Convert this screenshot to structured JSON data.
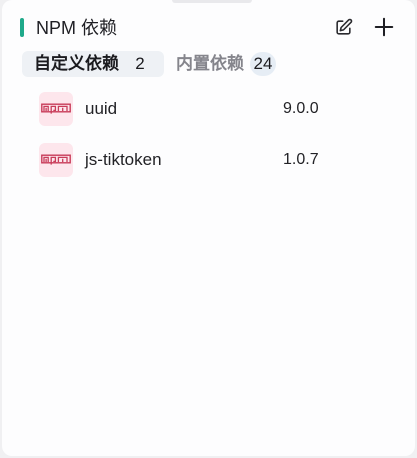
{
  "panel": {
    "title": "NPM 依赖",
    "accent_color": "#1fa98a",
    "actions": {
      "edit_icon": "edit-icon",
      "add_icon": "plus-icon"
    }
  },
  "tabs": [
    {
      "label": "自定义依赖",
      "count": "2",
      "active": true
    },
    {
      "label": "内置依赖",
      "count": "24",
      "active": false
    }
  ],
  "dependencies": [
    {
      "icon": "npm-icon",
      "name": "uuid",
      "version": "9.0.0"
    },
    {
      "icon": "npm-icon",
      "name": "js-tiktoken",
      "version": "1.0.7"
    }
  ]
}
